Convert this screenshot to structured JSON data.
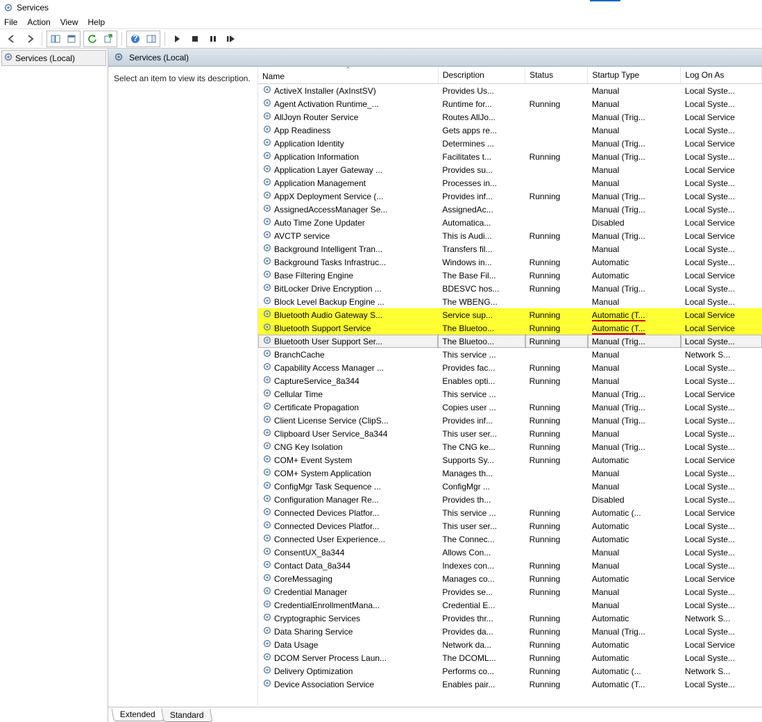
{
  "window": {
    "title": "Services"
  },
  "menus": [
    "File",
    "Action",
    "View",
    "Help"
  ],
  "toolbarTooltips": {
    "back": "Back",
    "forward": "Forward",
    "upRow": "Show/Hide Console Tree",
    "props": "Properties",
    "export": "Export List",
    "refresh": "Refresh",
    "help": "Help",
    "start": "Start Service",
    "stop": "Stop Service",
    "pause": "Pause Service",
    "restart": "Restart Service"
  },
  "tree": {
    "root": "Services (Local)"
  },
  "rightHeader": "Services (Local)",
  "descPrompt": "Select an item to view its description.",
  "columns": {
    "name": "Name",
    "desc": "Description",
    "status": "Status",
    "startup": "Startup Type",
    "logon": "Log On As"
  },
  "tabs": {
    "extended": "Extended",
    "standard": "Standard"
  },
  "services": [
    {
      "name": "ActiveX Installer (AxInstSV)",
      "desc": "Provides Us...",
      "status": "",
      "startup": "Manual",
      "logon": "Local Syste..."
    },
    {
      "name": "Agent Activation Runtime_...",
      "desc": "Runtime for...",
      "status": "Running",
      "startup": "Manual",
      "logon": "Local Syste..."
    },
    {
      "name": "AllJoyn Router Service",
      "desc": "Routes AllJo...",
      "status": "",
      "startup": "Manual (Trig...",
      "logon": "Local Service"
    },
    {
      "name": "App Readiness",
      "desc": "Gets apps re...",
      "status": "",
      "startup": "Manual",
      "logon": "Local Syste..."
    },
    {
      "name": "Application Identity",
      "desc": "Determines ...",
      "status": "",
      "startup": "Manual (Trig...",
      "logon": "Local Service"
    },
    {
      "name": "Application Information",
      "desc": "Facilitates t...",
      "status": "Running",
      "startup": "Manual (Trig...",
      "logon": "Local Syste..."
    },
    {
      "name": "Application Layer Gateway ...",
      "desc": "Provides su...",
      "status": "",
      "startup": "Manual",
      "logon": "Local Service"
    },
    {
      "name": "Application Management",
      "desc": "Processes in...",
      "status": "",
      "startup": "Manual",
      "logon": "Local Syste..."
    },
    {
      "name": "AppX Deployment Service (...",
      "desc": "Provides inf...",
      "status": "Running",
      "startup": "Manual (Trig...",
      "logon": "Local Syste..."
    },
    {
      "name": "AssignedAccessManager Se...",
      "desc": "AssignedAc...",
      "status": "",
      "startup": "Manual (Trig...",
      "logon": "Local Syste..."
    },
    {
      "name": "Auto Time Zone Updater",
      "desc": "Automatica...",
      "status": "",
      "startup": "Disabled",
      "logon": "Local Service"
    },
    {
      "name": "AVCTP service",
      "desc": "This is Audi...",
      "status": "Running",
      "startup": "Manual (Trig...",
      "logon": "Local Service"
    },
    {
      "name": "Background Intelligent Tran...",
      "desc": "Transfers fil...",
      "status": "",
      "startup": "Manual",
      "logon": "Local Syste..."
    },
    {
      "name": "Background Tasks Infrastruc...",
      "desc": "Windows in...",
      "status": "Running",
      "startup": "Automatic",
      "logon": "Local Syste..."
    },
    {
      "name": "Base Filtering Engine",
      "desc": "The Base Fil...",
      "status": "Running",
      "startup": "Automatic",
      "logon": "Local Service"
    },
    {
      "name": "BitLocker Drive Encryption ...",
      "desc": "BDESVC hos...",
      "status": "Running",
      "startup": "Manual (Trig...",
      "logon": "Local Syste..."
    },
    {
      "name": "Block Level Backup Engine ...",
      "desc": "The WBENG...",
      "status": "",
      "startup": "Manual",
      "logon": "Local Syste..."
    },
    {
      "name": "Bluetooth Audio Gateway S...",
      "desc": "Service sup...",
      "status": "Running",
      "startup": "Automatic (T...",
      "logon": "Local Service",
      "hl": true,
      "red": true
    },
    {
      "name": "Bluetooth Support Service",
      "desc": "The Bluetoo...",
      "status": "Running",
      "startup": "Automatic (T...",
      "logon": "Local Service",
      "hl": true,
      "red": true
    },
    {
      "name": "Bluetooth User Support Ser...",
      "desc": "The Bluetoo...",
      "status": "Running",
      "startup": "Manual (Trig...",
      "logon": "Local Syste...",
      "focused": true
    },
    {
      "name": "BranchCache",
      "desc": "This service ...",
      "status": "",
      "startup": "Manual",
      "logon": "Network S..."
    },
    {
      "name": "Capability Access Manager ...",
      "desc": "Provides fac...",
      "status": "Running",
      "startup": "Manual",
      "logon": "Local Syste..."
    },
    {
      "name": "CaptureService_8a344",
      "desc": "Enables opti...",
      "status": "Running",
      "startup": "Manual",
      "logon": "Local Syste..."
    },
    {
      "name": "Cellular Time",
      "desc": "This service ...",
      "status": "",
      "startup": "Manual (Trig...",
      "logon": "Local Service"
    },
    {
      "name": "Certificate Propagation",
      "desc": "Copies user ...",
      "status": "Running",
      "startup": "Manual (Trig...",
      "logon": "Local Syste..."
    },
    {
      "name": "Client License Service (ClipS...",
      "desc": "Provides inf...",
      "status": "Running",
      "startup": "Manual (Trig...",
      "logon": "Local Syste..."
    },
    {
      "name": "Clipboard User Service_8a344",
      "desc": "This user ser...",
      "status": "Running",
      "startup": "Manual",
      "logon": "Local Syste..."
    },
    {
      "name": "CNG Key Isolation",
      "desc": "The CNG ke...",
      "status": "Running",
      "startup": "Manual (Trig...",
      "logon": "Local Syste..."
    },
    {
      "name": "COM+ Event System",
      "desc": "Supports Sy...",
      "status": "Running",
      "startup": "Automatic",
      "logon": "Local Service"
    },
    {
      "name": "COM+ System Application",
      "desc": "Manages th...",
      "status": "",
      "startup": "Manual",
      "logon": "Local Syste..."
    },
    {
      "name": "ConfigMgr Task Sequence ...",
      "desc": "ConfigMgr ...",
      "status": "",
      "startup": "Manual",
      "logon": "Local Syste..."
    },
    {
      "name": "Configuration Manager Re...",
      "desc": "Provides th...",
      "status": "",
      "startup": "Disabled",
      "logon": "Local Syste..."
    },
    {
      "name": "Connected Devices Platfor...",
      "desc": "This service ...",
      "status": "Running",
      "startup": "Automatic (...",
      "logon": "Local Service"
    },
    {
      "name": "Connected Devices Platfor...",
      "desc": "This user ser...",
      "status": "Running",
      "startup": "Automatic",
      "logon": "Local Syste..."
    },
    {
      "name": "Connected User Experience...",
      "desc": "The Connec...",
      "status": "Running",
      "startup": "Automatic",
      "logon": "Local Syste..."
    },
    {
      "name": "ConsentUX_8a344",
      "desc": "Allows Con...",
      "status": "",
      "startup": "Manual",
      "logon": "Local Syste..."
    },
    {
      "name": "Contact Data_8a344",
      "desc": "Indexes con...",
      "status": "Running",
      "startup": "Manual",
      "logon": "Local Syste..."
    },
    {
      "name": "CoreMessaging",
      "desc": "Manages co...",
      "status": "Running",
      "startup": "Automatic",
      "logon": "Local Service"
    },
    {
      "name": "Credential Manager",
      "desc": "Provides se...",
      "status": "Running",
      "startup": "Manual",
      "logon": "Local Syste..."
    },
    {
      "name": "CredentialEnrollmentMana...",
      "desc": "Credential E...",
      "status": "",
      "startup": "Manual",
      "logon": "Local Syste..."
    },
    {
      "name": "Cryptographic Services",
      "desc": "Provides thr...",
      "status": "Running",
      "startup": "Automatic",
      "logon": "Network S..."
    },
    {
      "name": "Data Sharing Service",
      "desc": "Provides da...",
      "status": "Running",
      "startup": "Manual (Trig...",
      "logon": "Local Syste..."
    },
    {
      "name": "Data Usage",
      "desc": "Network da...",
      "status": "Running",
      "startup": "Automatic",
      "logon": "Local Service"
    },
    {
      "name": "DCOM Server Process Laun...",
      "desc": "The DCOML...",
      "status": "Running",
      "startup": "Automatic",
      "logon": "Local Syste..."
    },
    {
      "name": "Delivery Optimization",
      "desc": "Performs co...",
      "status": "Running",
      "startup": "Automatic (...",
      "logon": "Network S..."
    },
    {
      "name": "Device Association Service",
      "desc": "Enables pair...",
      "status": "Running",
      "startup": "Automatic (T...",
      "logon": "Local Syste..."
    }
  ]
}
